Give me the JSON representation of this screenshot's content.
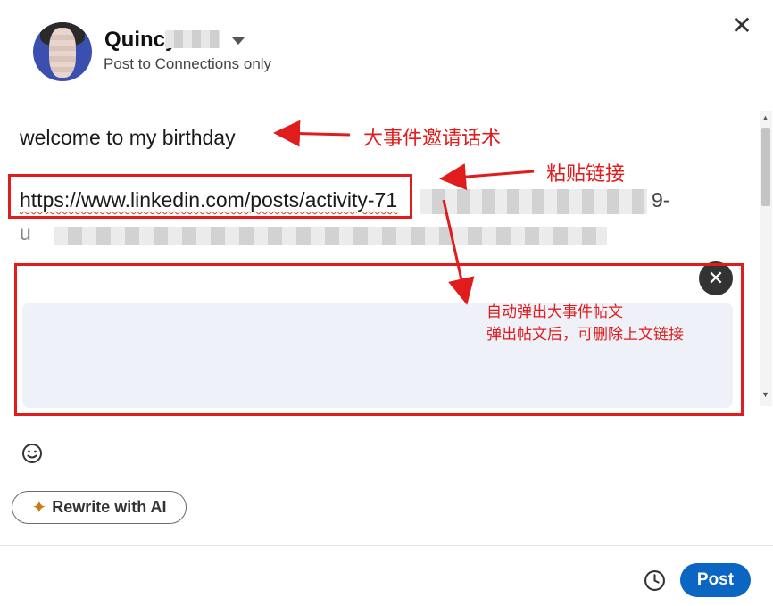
{
  "header": {
    "author_name": "Quincy",
    "audience": "Post to Connections only",
    "close_symbol": "✕"
  },
  "composer": {
    "text_line": "welcome to my birthday",
    "link_visible": "https://www.linkedin.com/posts/activity-71",
    "link_tail": "9-",
    "link_line2_start": "u"
  },
  "preview": {
    "remove_symbol": "✕"
  },
  "annotations": {
    "label1": "大事件邀请话术",
    "label2": "粘贴链接",
    "label3_line1": "自动弹出大事件帖文",
    "label3_line2": "弹出帖文后，可删除上文链接",
    "color": "#e01c1c"
  },
  "toolbar": {
    "emoji_icon": "smiley-icon",
    "ai_button_label": "Rewrite with AI",
    "ai_icon": "sparkle-icon"
  },
  "footer": {
    "schedule_icon": "clock-icon",
    "post_label": "Post",
    "accent": "#0a66c2"
  }
}
